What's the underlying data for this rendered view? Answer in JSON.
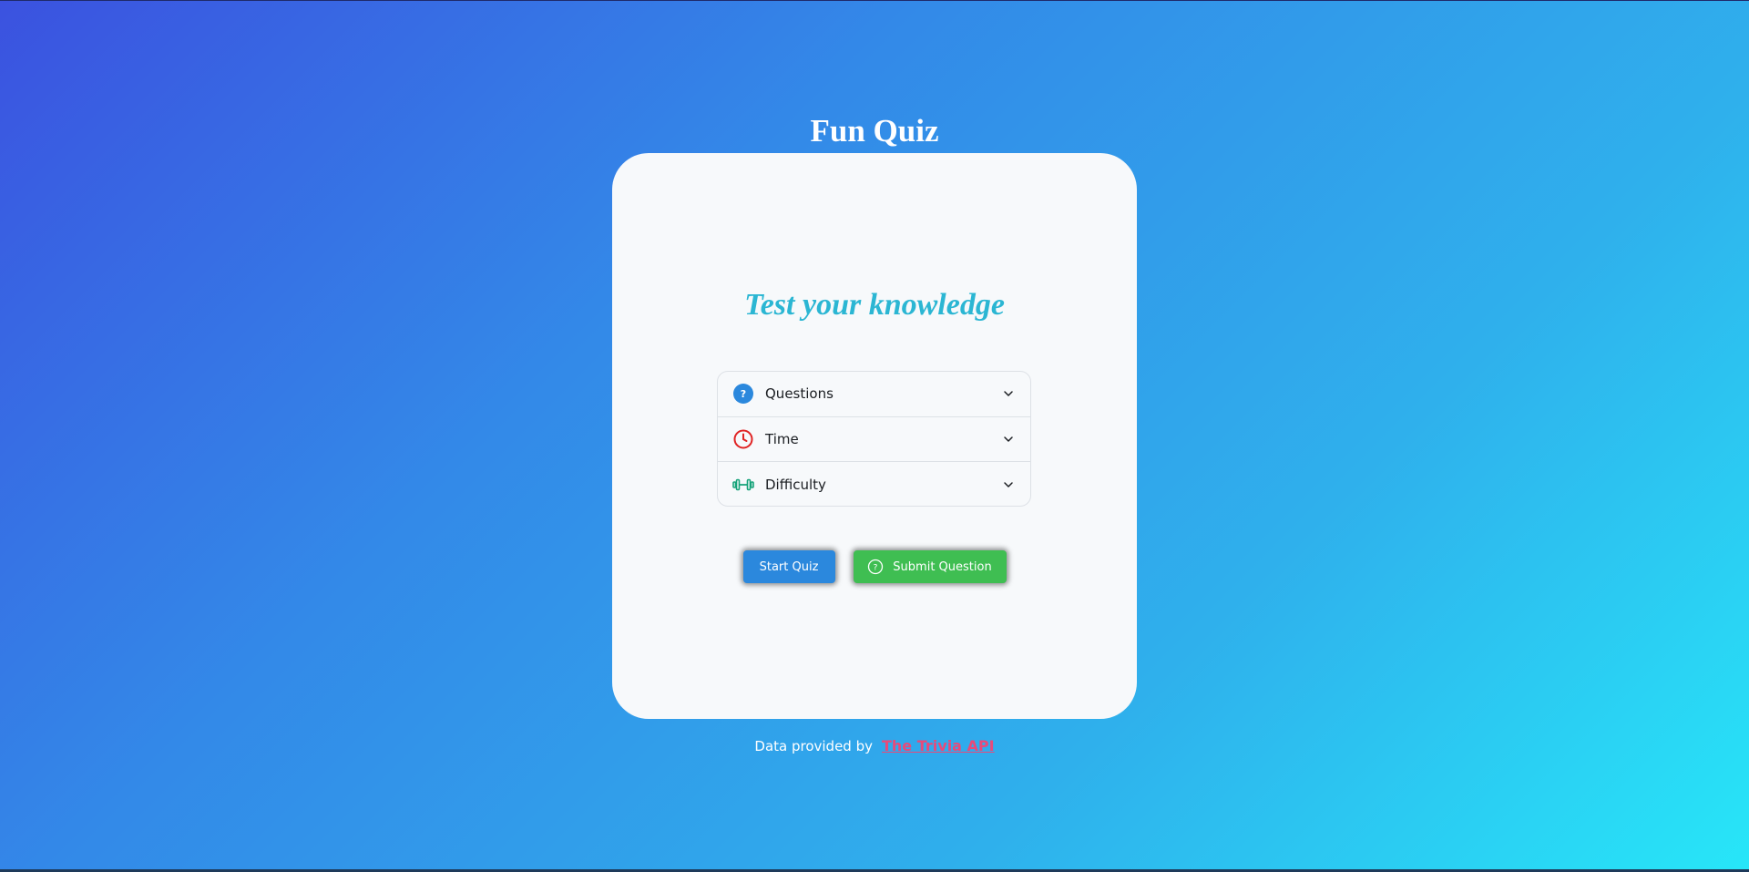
{
  "app": {
    "title": "Fun Quiz"
  },
  "card": {
    "subtitle": "Test your knowledge",
    "options": [
      {
        "label": "Questions",
        "icon": "question-circle-icon"
      },
      {
        "label": "Time",
        "icon": "clock-icon"
      },
      {
        "label": "Difficulty",
        "icon": "dumbbell-icon"
      }
    ],
    "buttons": {
      "start_label": "Start Quiz",
      "submit_label": "Submit Question"
    }
  },
  "footer": {
    "text": "Data provided by",
    "link_text": "The Trivia API"
  },
  "colors": {
    "accent_blue": "#2b88dd",
    "accent_green": "#3fbe52",
    "subtitle_cyan": "#2bb6d3",
    "link_pink": "#e84a7a",
    "time_red": "#e02424",
    "difficulty_green": "#16a37a"
  }
}
